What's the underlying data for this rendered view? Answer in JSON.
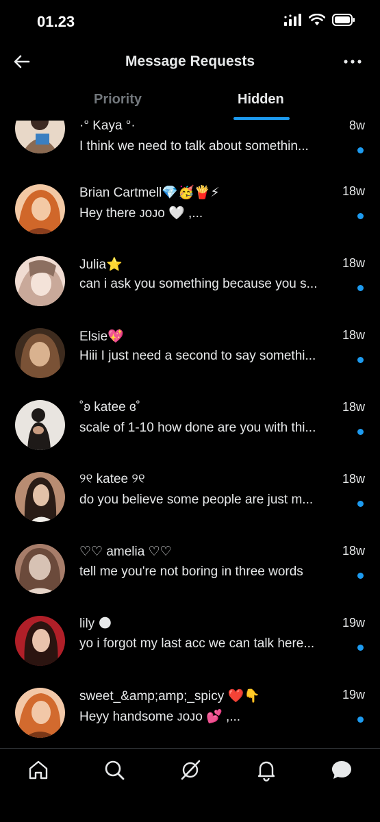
{
  "status_bar": {
    "time": "01.23"
  },
  "header": {
    "title": "Message Requests",
    "back_icon": "arrow-left-icon",
    "more_icon": "more-dots-icon"
  },
  "tabs": [
    {
      "label": "Priority",
      "active": false
    },
    {
      "label": "Hidden",
      "active": true
    }
  ],
  "colors": {
    "accent": "#1d9bf0",
    "text": "#e7e9ea",
    "muted": "#71767b",
    "background": "#000000",
    "divider": "#2f3336"
  },
  "messages": [
    {
      "name": "·° Kaya °·",
      "time": "8w",
      "preview": "I think we need to talk about somethin...",
      "unread": true,
      "avatar_palette": [
        "#e8d8c8",
        "#8a6a52",
        "#3a7fc1"
      ]
    },
    {
      "name": "Brian Cartmell💎🥳🍟⚡",
      "time": "18w",
      "preview": "Hey there ᴊᴏᴊᴏ 🤍 ,...",
      "unread": true,
      "avatar_palette": [
        "#d0672a",
        "#8a3e1d",
        "#f3c9a5"
      ]
    },
    {
      "name": "Julia⭐",
      "time": "18w",
      "preview": "can i ask you something because you s...",
      "unread": true,
      "avatar_palette": [
        "#f0dcd2",
        "#c9a99a",
        "#8c6f60"
      ]
    },
    {
      "name": "Elsie💖",
      "time": "18w",
      "preview": "Hiii I just need a second to say somethi...",
      "unread": true,
      "avatar_palette": [
        "#7a5236",
        "#d9b28f",
        "#3d2b1e"
      ]
    },
    {
      "name": "˚ʚ katee ɞ˚",
      "time": "18w",
      "preview": "scale of 1-10 how done are you with thi...",
      "unread": true,
      "avatar_palette": [
        "#e9e5e0",
        "#1e1a18",
        "#c79b80"
      ]
    },
    {
      "name": "୨୧ katee ୨୧",
      "time": "18w",
      "preview": "do you believe some people are just m...",
      "unread": true,
      "avatar_palette": [
        "#b88c72",
        "#2a1c16",
        "#f2efea"
      ]
    },
    {
      "name": "♡♡ amelia ♡♡",
      "time": "18w",
      "preview": "tell me you're not boring in three words",
      "unread": true,
      "avatar_palette": [
        "#d7c2b4",
        "#6b4a3b",
        "#a77d6a"
      ]
    },
    {
      "name": "lily 🌑",
      "time": "19w",
      "preview": "yo i forgot my last acc we can talk here...",
      "unread": true,
      "avatar_palette": [
        "#b01f28",
        "#2b1410",
        "#e9c3ad"
      ]
    },
    {
      "name": "sweet_&amp;amp;_spicy ❤️👇",
      "time": "19w",
      "preview": "Heyy handsome ᴊᴏᴊᴏ 💕 ,...",
      "unread": true,
      "avatar_palette": [
        "#d26a2e",
        "#7a3717",
        "#f2c8a8"
      ]
    }
  ],
  "bottom_nav": [
    {
      "name": "nav-home",
      "icon": "home-icon"
    },
    {
      "name": "nav-search",
      "icon": "search-icon"
    },
    {
      "name": "nav-grok",
      "icon": "grok-icon"
    },
    {
      "name": "nav-notifications",
      "icon": "bell-icon"
    },
    {
      "name": "nav-messages",
      "icon": "chat-bubble-icon"
    }
  ]
}
